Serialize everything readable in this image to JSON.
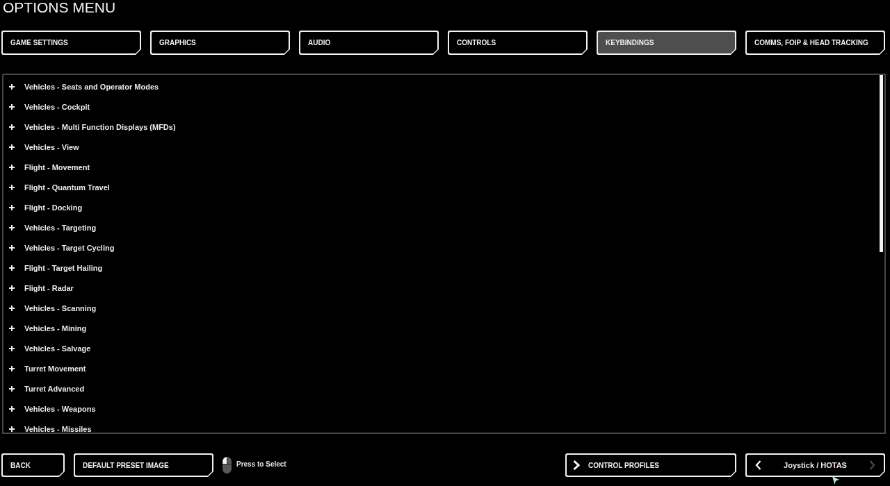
{
  "title": "OPTIONS MENU",
  "tabs": [
    {
      "label": "GAME SETTINGS",
      "selected": false
    },
    {
      "label": "GRAPHICS",
      "selected": false
    },
    {
      "label": "AUDIO",
      "selected": false
    },
    {
      "label": "CONTROLS",
      "selected": false
    },
    {
      "label": "KEYBINDINGS",
      "selected": true
    },
    {
      "label": "COMMS, FOIP & HEAD TRACKING",
      "selected": false
    }
  ],
  "categories": [
    {
      "label": "Vehicles - Seats and Operator Modes",
      "expanded": false
    },
    {
      "label": "Vehicles - Cockpit",
      "expanded": false
    },
    {
      "label": "Vehicles - Multi Function Displays (MFDs)",
      "expanded": false
    },
    {
      "label": "Vehicles - View",
      "expanded": false
    },
    {
      "label": "Flight - Movement",
      "expanded": false
    },
    {
      "label": "Flight - Quantum Travel",
      "expanded": false
    },
    {
      "label": "Flight - Docking",
      "expanded": false
    },
    {
      "label": "Vehicles - Targeting",
      "expanded": false
    },
    {
      "label": "Vehicles - Target Cycling",
      "expanded": false
    },
    {
      "label": "Flight - Target Hailing",
      "expanded": false
    },
    {
      "label": "Flight - Radar",
      "expanded": false
    },
    {
      "label": "Vehicles - Scanning",
      "expanded": false
    },
    {
      "label": "Vehicles - Mining",
      "expanded": false
    },
    {
      "label": "Vehicles - Salvage",
      "expanded": false
    },
    {
      "label": "Turret Movement",
      "expanded": false
    },
    {
      "label": "Turret Advanced",
      "expanded": false
    },
    {
      "label": "Vehicles - Weapons",
      "expanded": false
    },
    {
      "label": "Vehicles - Missiles",
      "expanded": false
    }
  ],
  "footer": {
    "back_button": "BACK",
    "preset_button": "DEFAULT PRESET IMAGE",
    "hint": "Press to Select",
    "profiles_button": "CONTROL PROFILES",
    "device_selector": {
      "value": "Joystick / HOTAS",
      "previous_disabled": false,
      "next_disabled": true
    }
  }
}
